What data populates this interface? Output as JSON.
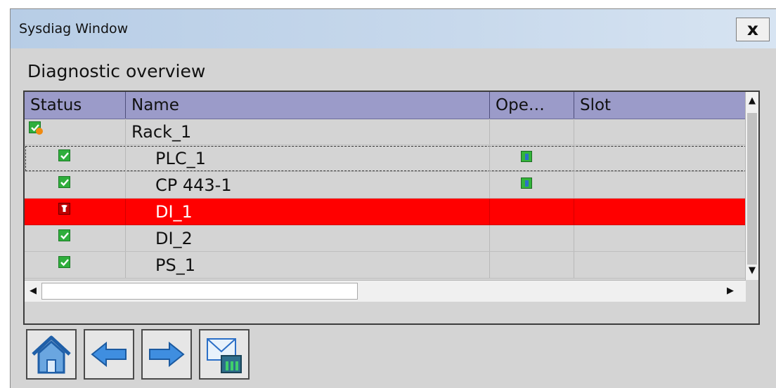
{
  "window": {
    "title": "Sysdiag Window",
    "close_label": "x"
  },
  "heading": "Diagnostic overview",
  "columns": {
    "status": "Status",
    "name": "Name",
    "ope": "Ope…",
    "slot": "Slot"
  },
  "rows": [
    {
      "name": "Rack_1",
      "status_icon": "ok-warning-icon",
      "operating_icon": ""
    },
    {
      "name": "PLC_1",
      "status_icon": "ok-check-icon",
      "operating_icon": "run-icon"
    },
    {
      "name": "CP 443-1",
      "status_icon": "ok-check-icon",
      "operating_icon": "run-icon"
    },
    {
      "name": "DI_1",
      "status_icon": "fault-wrench-icon",
      "operating_icon": ""
    },
    {
      "name": "DI_2",
      "status_icon": "ok-check-icon",
      "operating_icon": ""
    },
    {
      "name": "PS_1",
      "status_icon": "ok-check-icon",
      "operating_icon": ""
    }
  ],
  "colors": {
    "selected_row": "#ff0000",
    "header": "#9b9bc9",
    "titlebar": "#c8d9ec"
  },
  "toolbar": [
    "home-icon",
    "arrow-left-icon",
    "arrow-right-icon",
    "diagnostic-buffer-icon"
  ]
}
